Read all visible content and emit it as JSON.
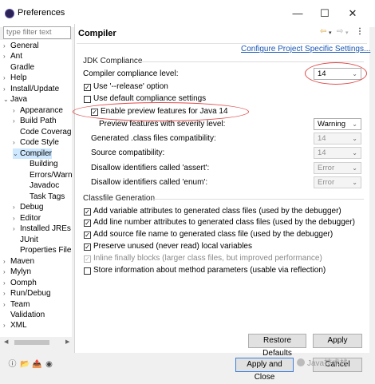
{
  "window": {
    "title": "Preferences"
  },
  "filter": {
    "placeholder": "type filter text"
  },
  "tree": [
    {
      "label": "General",
      "tw": "›",
      "indent": 0
    },
    {
      "label": "Ant",
      "tw": "›",
      "indent": 0
    },
    {
      "label": "Gradle",
      "tw": "",
      "indent": 0
    },
    {
      "label": "Help",
      "tw": "›",
      "indent": 0
    },
    {
      "label": "Install/Update",
      "tw": "›",
      "indent": 0
    },
    {
      "label": "Java",
      "tw": "⌄",
      "indent": 0
    },
    {
      "label": "Appearance",
      "tw": "›",
      "indent": 1
    },
    {
      "label": "Build Path",
      "tw": "›",
      "indent": 1
    },
    {
      "label": "Code Coverage",
      "tw": "",
      "indent": 1
    },
    {
      "label": "Code Style",
      "tw": "›",
      "indent": 1
    },
    {
      "label": "Compiler",
      "tw": "⌄",
      "indent": 1
    },
    {
      "label": "Building",
      "tw": "",
      "indent": 2
    },
    {
      "label": "Errors/Warnings",
      "tw": "",
      "indent": 2
    },
    {
      "label": "Javadoc",
      "tw": "",
      "indent": 2
    },
    {
      "label": "Task Tags",
      "tw": "",
      "indent": 2
    },
    {
      "label": "Debug",
      "tw": "›",
      "indent": 1
    },
    {
      "label": "Editor",
      "tw": "›",
      "indent": 1
    },
    {
      "label": "Installed JREs",
      "tw": "›",
      "indent": 1
    },
    {
      "label": "JUnit",
      "tw": "",
      "indent": 1
    },
    {
      "label": "Properties Files",
      "tw": "",
      "indent": 1
    },
    {
      "label": "Maven",
      "tw": "›",
      "indent": 0
    },
    {
      "label": "Mylyn",
      "tw": "›",
      "indent": 0
    },
    {
      "label": "Oomph",
      "tw": "›",
      "indent": 0
    },
    {
      "label": "Run/Debug",
      "tw": "›",
      "indent": 0
    },
    {
      "label": "Team",
      "tw": "›",
      "indent": 0
    },
    {
      "label": "Validation",
      "tw": "",
      "indent": 0
    },
    {
      "label": "XML",
      "tw": "›",
      "indent": 0
    }
  ],
  "page": {
    "title": "Compiler",
    "configure_link": "Configure Project Specific Settings...",
    "jdk_group": "JDK Compliance",
    "compliance_label": "Compiler compliance level:",
    "compliance_value": "14",
    "release_label": "Use '--release' option",
    "default_compliance_label": "Use default compliance settings",
    "preview_label": "Enable preview features for Java 14",
    "preview_severity_label": "Preview features with severity level:",
    "preview_severity_value": "Warning",
    "class_compat_label": "Generated .class files compatibility:",
    "class_compat_value": "14",
    "source_compat_label": "Source compatibility:",
    "source_compat_value": "14",
    "assert_label": "Disallow identifiers called 'assert':",
    "assert_value": "Error",
    "enum_label": "Disallow identifiers called 'enum':",
    "enum_value": "Error",
    "classfile_group": "Classfile Generation",
    "cf1": "Add variable attributes to generated class files (used by the debugger)",
    "cf2": "Add line number attributes to generated class files (used by the debugger)",
    "cf3": "Add source file name to generated class file (used by the debugger)",
    "cf4": "Preserve unused (never read) local variables",
    "cf5": "Inline finally blocks (larger class files, but improved performance)",
    "cf6": "Store information about method parameters (usable via reflection)"
  },
  "buttons": {
    "restore": "Restore Defaults",
    "apply": "Apply",
    "apply_close": "Apply and Close",
    "cancel": "Cancel"
  },
  "watermark": "Java技术栈"
}
